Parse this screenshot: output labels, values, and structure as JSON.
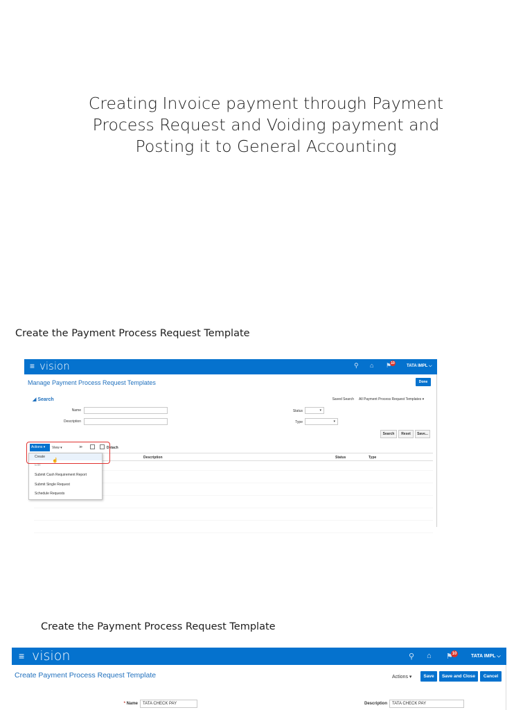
{
  "doc": {
    "title_lines": [
      "Creating Invoice payment through Payment",
      "Process Request and Voiding payment and",
      "Posting it to General Accounting"
    ],
    "caption_1": "Create the Payment Process Request Template",
    "caption_2": "Create the Payment Process Request Template"
  },
  "shot1": {
    "brand": "vision",
    "menu_icon": "≡",
    "icons": {
      "search": "search-icon",
      "home": "home-icon",
      "notifications": "notifications-icon"
    },
    "search_glyph": "⚲",
    "home_glyph": "⌂",
    "notif_glyph": "⚑",
    "notif_count": "10",
    "user": "TATA IMPL ⌵",
    "page_title": "Manage Payment Process Request Templates",
    "done_label": "Done",
    "search": {
      "heading": "◢ Search",
      "name_label": "Name",
      "description_label": "Description",
      "status_label": "Status",
      "type_label": "Type",
      "saved_search_label": "Saved Search",
      "saved_search_value": "All Payment Process Request Templates ▾",
      "dropdown_arrow": "▾",
      "search_btn": "Search",
      "reset_btn": "Reset",
      "save_btn": "Save..."
    },
    "toolbar": {
      "actions": "Actions ▾",
      "view": "View ▾",
      "more": "≫",
      "detach": "Detach"
    },
    "table_headers": {
      "description": "Description",
      "status": "Status",
      "type": "Type"
    },
    "actions_menu": {
      "create": "Create",
      "edit": "Edit",
      "submit_cash": "Submit Cash Requirement Report",
      "submit_single": "Submit Single Request",
      "schedule": "Schedule Requests"
    },
    "colors": {
      "brand_blue": "#0572ce",
      "highlight_red": "#e0312f"
    }
  },
  "shot2": {
    "brand": "vision",
    "menu_icon": "≡",
    "search_glyph": "⚲",
    "home_glyph": "⌂",
    "notif_glyph": "⚑",
    "notif_count": "10",
    "user": "TATA IMPL ⌵",
    "page_title": "Create Payment Process Request Template",
    "actions": "Actions ▾",
    "save": "Save",
    "save_and_close": "Save and Close",
    "cancel": "Cancel",
    "required_mark": "*",
    "name_label": "Name",
    "name_value": "TATA CHECK PAY",
    "description_label": "Description",
    "description_value": "TATA CHECK PAY"
  }
}
